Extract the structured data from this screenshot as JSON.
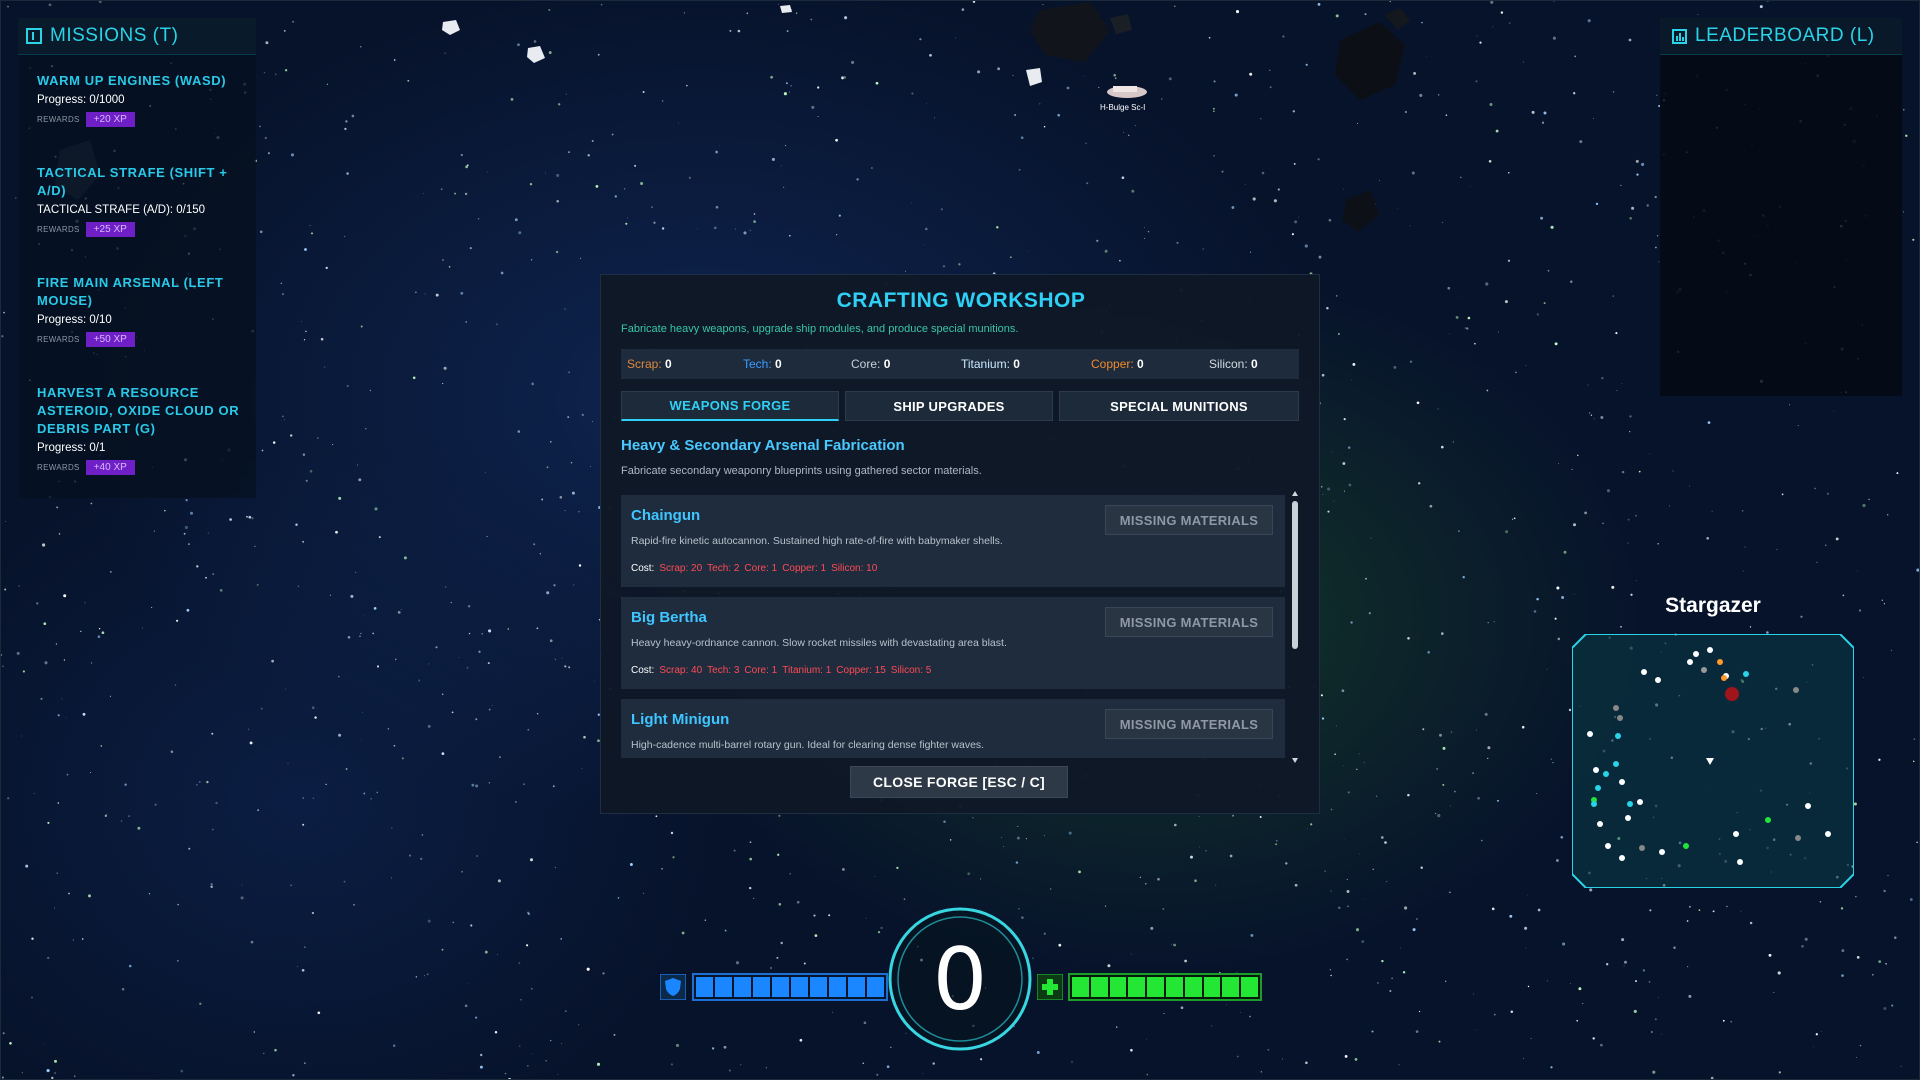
{
  "missions": {
    "header": "MISSIONS (T)",
    "reward_label": "REWARDS",
    "items": [
      {
        "title": "WARM UP ENGINES (WASD)",
        "progress": "Progress: 0/1000",
        "reward": "+20 XP"
      },
      {
        "title": "TACTICAL STRAFE (SHIFT + A/D)",
        "progress": "TACTICAL STRAFE (A/D): 0/150",
        "reward": "+25 XP"
      },
      {
        "title": "FIRE MAIN ARSENAL (LEFT MOUSE)",
        "progress": "Progress: 0/10",
        "reward": "+50 XP"
      },
      {
        "title": "HARVEST A RESOURCE ASTEROID, OXIDE CLOUD OR DEBRIS PART (G)",
        "progress": "Progress: 0/1",
        "reward": "+40 XP"
      }
    ]
  },
  "leaderboard": {
    "header": "LEADERBOARD (L)"
  },
  "world": {
    "ship_label": "H-Bulge Sc-I"
  },
  "crafting": {
    "title": "CRAFTING WORKSHOP",
    "subtitle": "Fabricate heavy weapons, upgrade ship modules, and produce special munitions.",
    "resources": [
      {
        "label": "Scrap:",
        "value": "0",
        "color": "#e0873a"
      },
      {
        "label": "Tech:",
        "value": "0",
        "color": "#3b9dff"
      },
      {
        "label": "Core:",
        "value": "0",
        "color": "#c9cfd6"
      },
      {
        "label": "Titanium:",
        "value": "0",
        "color": "#c9e8ff"
      },
      {
        "label": "Copper:",
        "value": "0",
        "color": "#f08a2c"
      },
      {
        "label": "Silicon:",
        "value": "0",
        "color": "#d6dbe0"
      }
    ],
    "tabs": [
      {
        "label": "WEAPONS FORGE",
        "active": true
      },
      {
        "label": "SHIP UPGRADES",
        "active": false
      },
      {
        "label": "SPECIAL MUNITIONS",
        "active": false
      }
    ],
    "section_title": "Heavy & Secondary Arsenal Fabrication",
    "section_desc": "Fabricate secondary weaponry blueprints using gathered sector materials.",
    "cost_label": "Cost:",
    "button_label": "MISSING MATERIALS",
    "items": [
      {
        "name": "Chaingun",
        "desc": "Rapid-fire kinetic autocannon. Sustained high rate-of-fire with babymaker shells.",
        "costs": [
          "Scrap: 20",
          "Tech: 2",
          "Core: 1",
          "Copper: 1",
          "Silicon: 10"
        ]
      },
      {
        "name": "Big Bertha",
        "desc": "Heavy heavy-ordnance cannon. Slow rocket missiles with devastating area blast.",
        "costs": [
          "Scrap: 40",
          "Tech: 3",
          "Core: 1",
          "Titanium: 1",
          "Copper: 15",
          "Silicon: 5"
        ]
      },
      {
        "name": "Light Minigun",
        "desc": "High-cadence multi-barrel rotary gun. Ideal for clearing dense fighter waves.",
        "costs": []
      }
    ],
    "close_label": "CLOSE FORGE [ESC / C]"
  },
  "minimap": {
    "title": "Stargazer"
  },
  "hud": {
    "speed": "0",
    "shield_fraction": 1.0,
    "health_fraction": 1.0,
    "shield_color": "#1a86ff",
    "health_color": "#23e635"
  }
}
